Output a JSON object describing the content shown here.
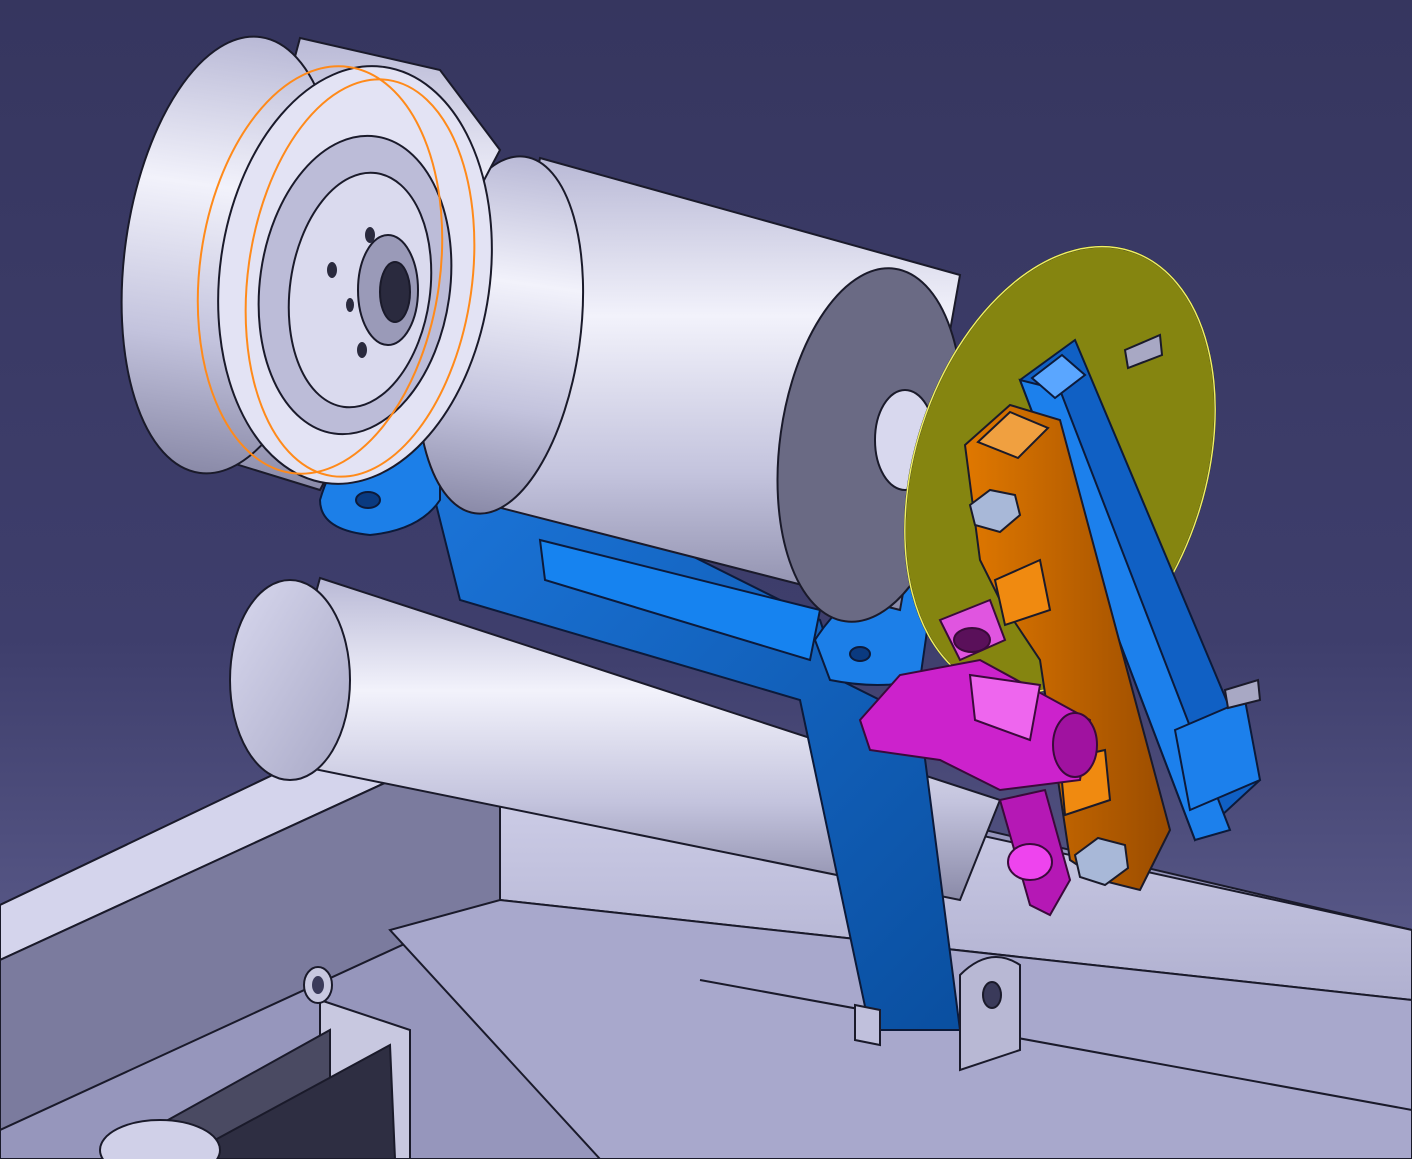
{
  "viewport": {
    "background_top": "#36365f",
    "background_bottom": "#6a6a9a"
  },
  "colors": {
    "steel": "#c8c8e6",
    "steel_dark": "#9a9ab8",
    "bracket_blue": "#0a57b0",
    "bracket_light": "#1c7fe8",
    "orange_arm": "#c86a00",
    "olive_disc": "#8a8a10",
    "magenta": "#cc22cc",
    "highlight_orange": "#ff8a1a"
  }
}
